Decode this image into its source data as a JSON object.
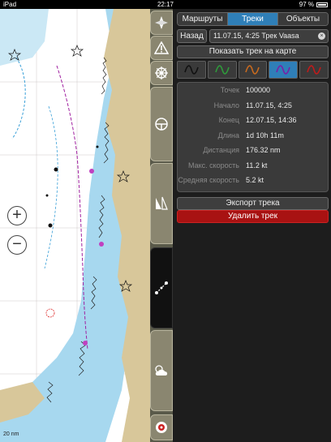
{
  "status_bar": {
    "carrier": "iPad",
    "time": "22:17",
    "battery_percent": "97 %"
  },
  "map": {
    "scale_label": "20 nm",
    "zoom_in_label": "+",
    "zoom_out_label": "−",
    "colors": {
      "water": "#ffffff",
      "shallow": "#a7d8ef",
      "land": "#d8c79a",
      "track": "#a020a0"
    }
  },
  "toolbar": {
    "items": [
      {
        "name": "compass-icon"
      },
      {
        "name": "warning-icon"
      },
      {
        "name": "ship-wheel-icon"
      },
      {
        "name": "steering-icon"
      },
      {
        "name": "sail-icon"
      },
      {
        "name": "route-icon"
      },
      {
        "name": "weather-icon"
      },
      {
        "name": "settings-icon"
      }
    ]
  },
  "panel": {
    "tabs": [
      {
        "label": "Маршруты",
        "active": false
      },
      {
        "label": "Треки",
        "active": true
      },
      {
        "label": "Объекты",
        "active": false
      }
    ],
    "back_label": "Назад",
    "track_title": "11.07.15, 4:25 Трек Vaasa",
    "show_on_map_label": "Показать трек на карте",
    "track_styles": [
      {
        "name": "style-black",
        "color": "#111111",
        "active": false
      },
      {
        "name": "style-green",
        "color": "#2e9b3a",
        "active": false
      },
      {
        "name": "style-orange",
        "color": "#c86a1e",
        "active": false
      },
      {
        "name": "style-purple",
        "color": "#7a1fa8",
        "active": true
      },
      {
        "name": "style-red",
        "color": "#c21a1a",
        "active": false
      }
    ],
    "stats": [
      {
        "label": "Точек",
        "value": "100000"
      },
      {
        "label": "Начало",
        "value": "11.07.15, 4:25"
      },
      {
        "label": "Конец",
        "value": "12.07.15, 14:36"
      },
      {
        "label": "Длина",
        "value": "1d 10h 11m"
      },
      {
        "label": "Дистанция",
        "value": "176.32 nm"
      },
      {
        "label": "Макс. скорость",
        "value": "11.2 kt"
      },
      {
        "label": "Средняя скорость",
        "value": "5.2 kt"
      }
    ],
    "export_label": "Экспорт трека",
    "delete_label": "Удалить трек"
  }
}
